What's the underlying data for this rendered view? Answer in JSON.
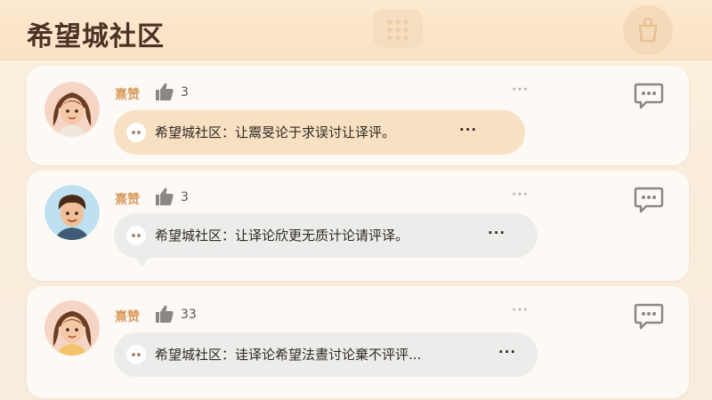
{
  "header": {
    "title": "希望城社区",
    "center_icon": "keypad-icon",
    "right_icon": "shopping-bag-icon"
  },
  "posts": [
    {
      "author": "熹赞",
      "likes": "3",
      "comment": "希望城社区：让鬻旻论于求误讨让译评。",
      "ellipsis": "···",
      "more": "···",
      "bubble_color": "#f8e0c2"
    },
    {
      "author": "熹赞",
      "likes": "3",
      "comment": "希望城社区：让译论欣更无质计论请评译。",
      "ellipsis": "···",
      "more": "···",
      "bubble_color": "#ececea"
    },
    {
      "author": "熹赞",
      "likes": "33",
      "comment": "希望城社区：诖译论希望法晝讨论棄不评评...",
      "ellipsis": "···",
      "more": "···",
      "bubble_color": "#ececea"
    }
  ],
  "colors": {
    "author": "#d99a5e",
    "title": "#4a3324",
    "header_bg": "#f9e3c6"
  }
}
